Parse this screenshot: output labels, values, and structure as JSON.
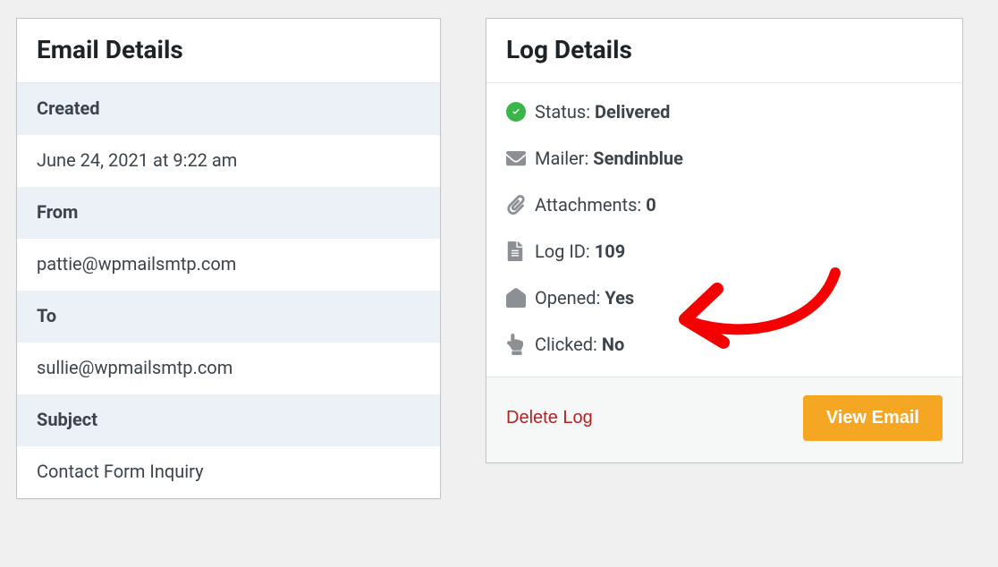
{
  "email_details": {
    "title": "Email Details",
    "created_label": "Created",
    "created_value": "June 24, 2021 at 9:22 am",
    "from_label": "From",
    "from_value": "pattie@wpmailsmtp.com",
    "to_label": "To",
    "to_value": "sullie@wpmailsmtp.com",
    "subject_label": "Subject",
    "subject_value": "Contact Form Inquiry"
  },
  "log_details": {
    "title": "Log Details",
    "status_label": "Status:",
    "status_value": "Delivered",
    "mailer_label": "Mailer:",
    "mailer_value": "Sendinblue",
    "attachments_label": "Attachments:",
    "attachments_value": "0",
    "logid_label": "Log ID:",
    "logid_value": "109",
    "opened_label": "Opened:",
    "opened_value": "Yes",
    "clicked_label": "Clicked:",
    "clicked_value": "No",
    "delete_label": "Delete Log",
    "view_label": "View Email"
  }
}
